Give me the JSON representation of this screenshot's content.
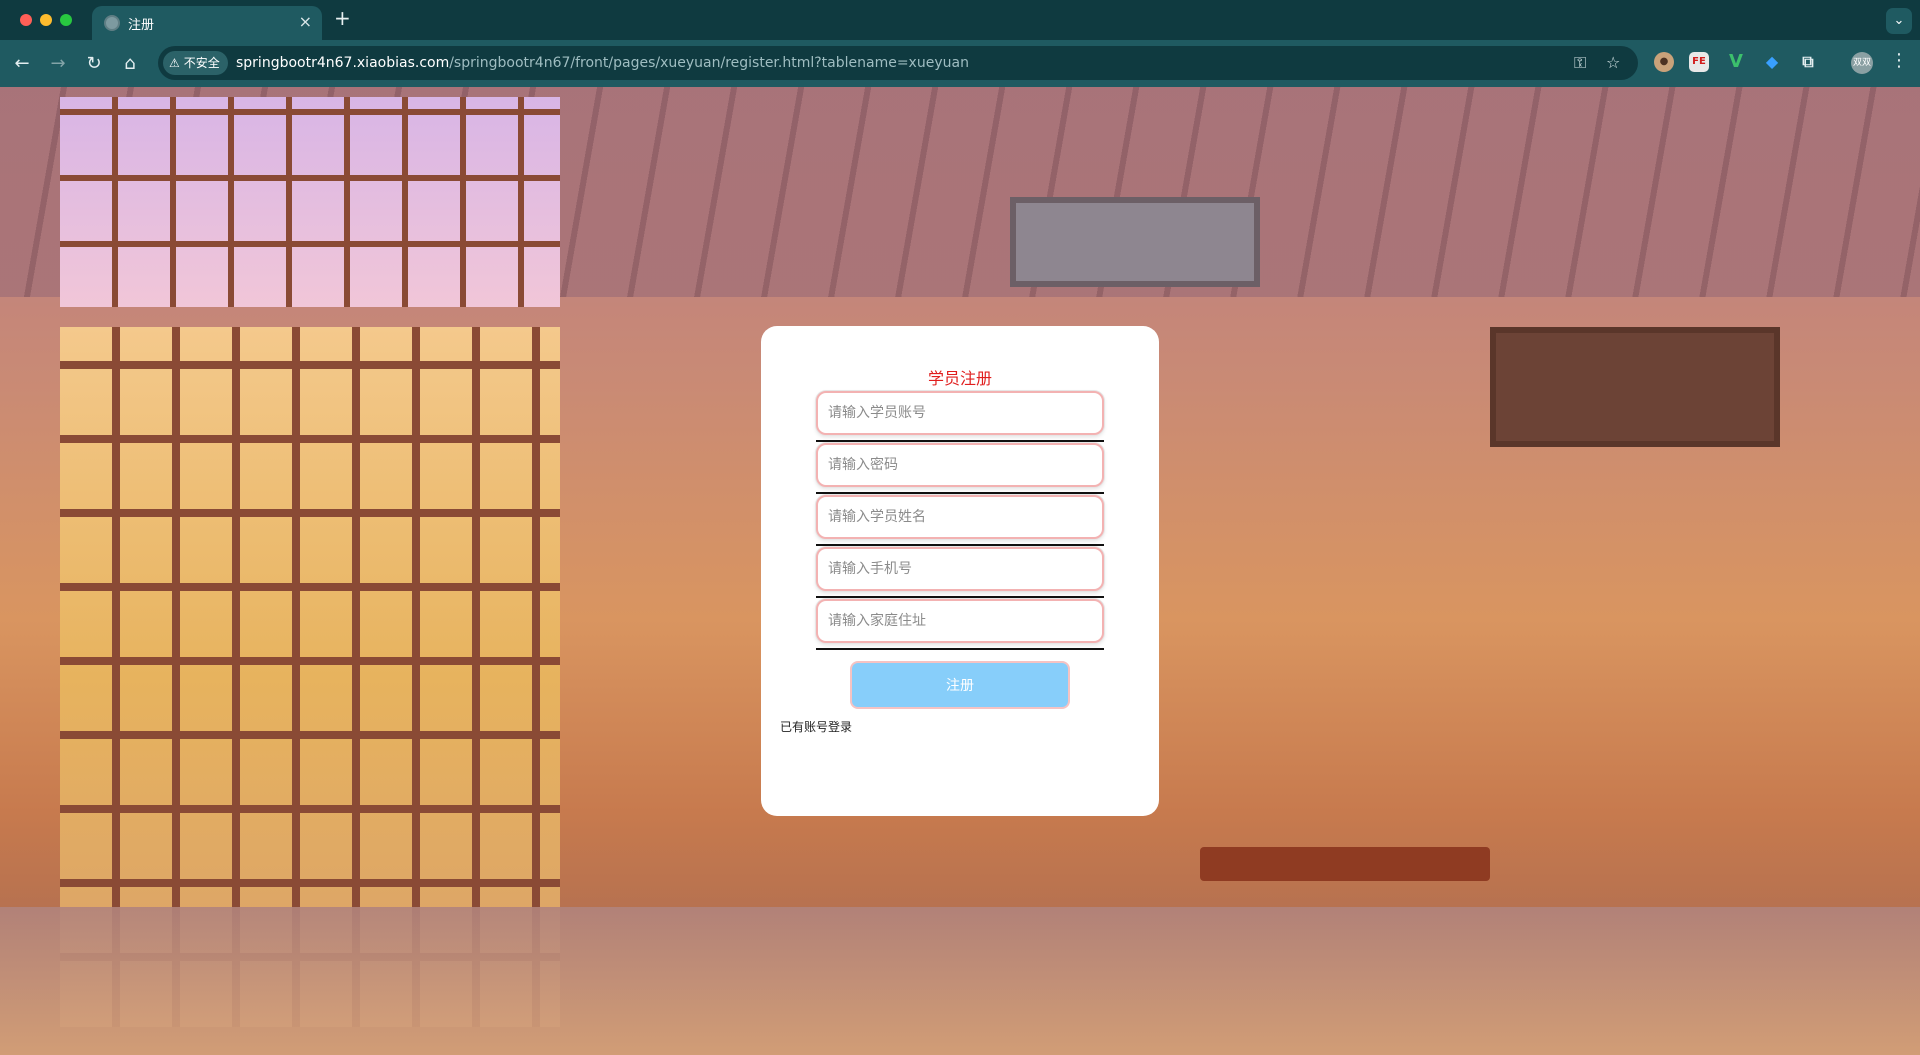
{
  "browser": {
    "tab_title": "注册",
    "tab_close": "×",
    "new_tab": "+",
    "tab_menu": "⌄",
    "nav": {
      "back": "←",
      "forward": "→",
      "reload": "↻",
      "home": "⌂"
    },
    "security_label": "不安全",
    "url_host": "springbootr4n67.xiaobias.com",
    "url_path": "/springbootr4n67/front/pages/xueyuan/register.html?tablename=xueyuan",
    "icons": {
      "password_key": "key-icon",
      "bookmark": "star-icon",
      "extensions": "puzzle-icon",
      "menu": "kebab-icon"
    },
    "extensions": {
      "fe": "FE",
      "v": "V",
      "gem": "◆",
      "puzzle": "⧉"
    },
    "profile_label": "双双",
    "menu_glyph": "⋮"
  },
  "register": {
    "title": "学员注册",
    "fields": [
      {
        "placeholder": "请输入学员账号",
        "value": ""
      },
      {
        "placeholder": "请输入密码",
        "value": ""
      },
      {
        "placeholder": "请输入学员姓名",
        "value": ""
      },
      {
        "placeholder": "请输入手机号",
        "value": ""
      },
      {
        "placeholder": "请输入家庭住址",
        "value": ""
      }
    ],
    "submit_label": "注册",
    "login_link": "已有账号登录"
  },
  "colors": {
    "title": "#e01e1e",
    "button": "#87cefa",
    "field_border": "#f3b2b2",
    "chrome_toolbar": "#1f5a61",
    "chrome_tabbar": "#0f3a40"
  }
}
